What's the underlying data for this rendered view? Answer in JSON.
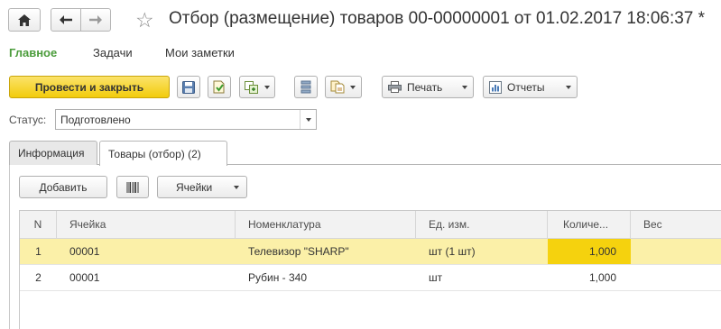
{
  "window": {
    "title": "Отбор (размещение) товаров 00-00000001 от 01.02.2017 18:06:37 *"
  },
  "menu": {
    "items": [
      "Главное",
      "Задачи",
      "Мои заметки"
    ]
  },
  "toolbar": {
    "post_close_label": "Провести и закрыть",
    "print_label": "Печать",
    "reports_label": "Отчеты"
  },
  "status": {
    "label": "Статус:",
    "value": "Подготовлено"
  },
  "tabs": [
    "Информация",
    "Товары (отбор) (2)"
  ],
  "goods_toolbar": {
    "add_label": "Добавить",
    "cells_label": "Ячейки"
  },
  "table": {
    "columns": [
      "N",
      "Ячейка",
      "Номенклатура",
      "Ед. изм.",
      "Количе...",
      "Вес"
    ],
    "rows": [
      [
        "1",
        "00001",
        "Телевизор \"SHARP\"",
        "шт (1 шт)",
        "1,000",
        ""
      ],
      [
        "2",
        "00001",
        "Рубин - 340",
        "шт",
        "1,000",
        ""
      ]
    ]
  },
  "colors": {
    "accent_green": "#4b9c3b",
    "primary_button": "#f2cc0c",
    "selected_row": "#fbf0a8",
    "focused_cell": "#f5d20e"
  }
}
